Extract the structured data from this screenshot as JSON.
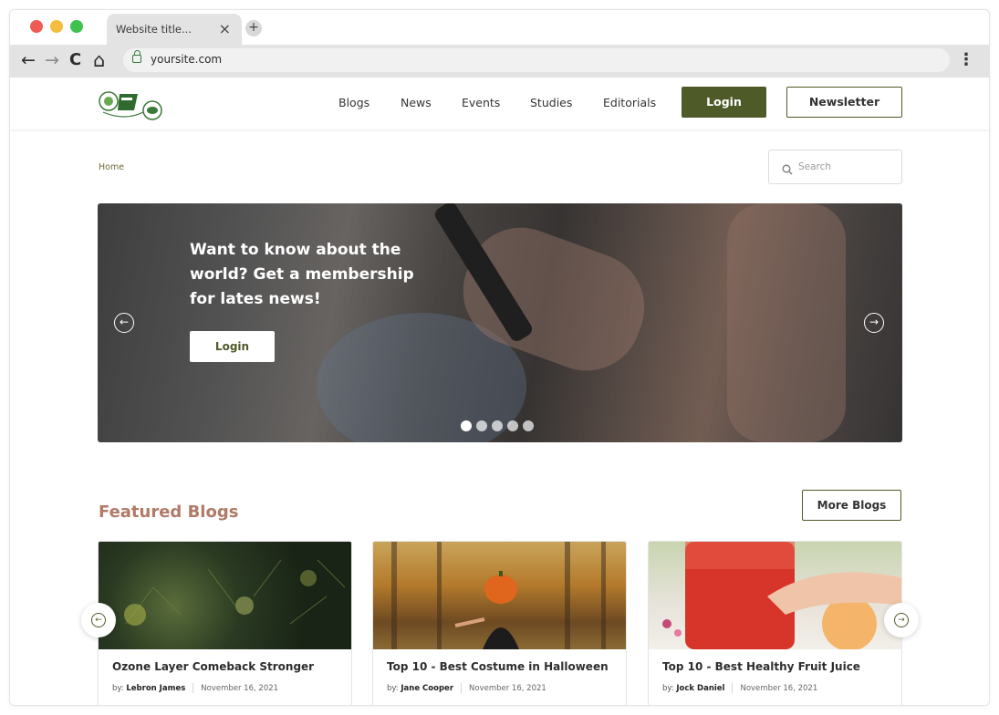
{
  "browser": {
    "tab_title": "Website title...",
    "tab_close": "×",
    "new_tab": "+",
    "url": "yoursite.com",
    "back_icon": "←",
    "forward_icon": "→",
    "reload_icon": "C",
    "home_icon": "⌂",
    "menu_icon": "⋮"
  },
  "header": {
    "nav": [
      "Blogs",
      "News",
      "Events",
      "Studies",
      "Editorials"
    ],
    "login_label": "Login",
    "newsletter_label": "Newsletter"
  },
  "breadcrumb": "Home",
  "search": {
    "placeholder": "Search"
  },
  "hero": {
    "text": "Want to know about the world? Get a membership for lates news!",
    "login_label": "Login",
    "prev_icon": "←",
    "next_icon": "→",
    "dots": 5,
    "active_dot": 0
  },
  "featured": {
    "title": "Featured Blogs",
    "more_label": "More Blogs",
    "prev_icon": "←",
    "next_icon": "→",
    "cards": [
      {
        "title": "Ozone Layer Comeback Stronger",
        "by": "by:",
        "author": "Lebron James",
        "date": "November 16, 2021"
      },
      {
        "title": "Top 10 - Best Costume in Halloween",
        "by": "by:",
        "author": "Jane Cooper",
        "date": "November 16, 2021"
      },
      {
        "title": "Top 10 - Best Healthy Fruit Juice",
        "by": "by:",
        "author": "Jock Daniel",
        "date": "November 16, 2021"
      }
    ]
  },
  "colors": {
    "brand_green": "#4e5a27",
    "section_title": "#b07a67"
  }
}
